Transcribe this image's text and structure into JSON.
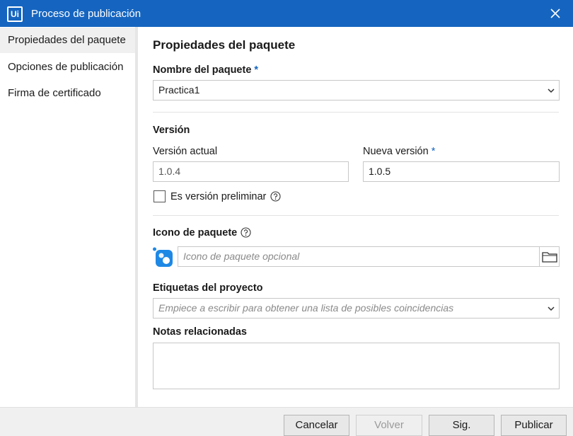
{
  "window": {
    "title": "Proceso de publicación",
    "logo_text": "Ui"
  },
  "sidebar": {
    "items": [
      {
        "label": "Propiedades del paquete"
      },
      {
        "label": "Opciones de publicación"
      },
      {
        "label": "Firma de certificado"
      }
    ]
  },
  "main": {
    "heading": "Propiedades del paquete",
    "package_name": {
      "label": "Nombre del paquete",
      "required_mark": "*",
      "value": "Practica1"
    },
    "version": {
      "section_label": "Versión",
      "current_label": "Versión actual",
      "current_value": "1.0.4",
      "new_label": "Nueva versión",
      "new_required_mark": "*",
      "new_value": "1.0.5",
      "prerelease_label": "Es versión preliminar",
      "prerelease_checked": false
    },
    "package_icon": {
      "label": "Icono de paquete",
      "placeholder": "Icono de paquete opcional"
    },
    "project_tags": {
      "label": "Etiquetas del proyecto",
      "placeholder": "Empiece a escribir para obtener una lista de posibles coincidencias"
    },
    "release_notes": {
      "label": "Notas relacionadas",
      "value": ""
    }
  },
  "footer": {
    "cancel": "Cancelar",
    "back": "Volver",
    "next": "Sig.",
    "publish": "Publicar"
  },
  "colors": {
    "accent": "#1565c0",
    "titlebar_text": "#ffffff",
    "sidebar_active": "#f0f0f0",
    "footer_bg": "#f0f0f0"
  }
}
